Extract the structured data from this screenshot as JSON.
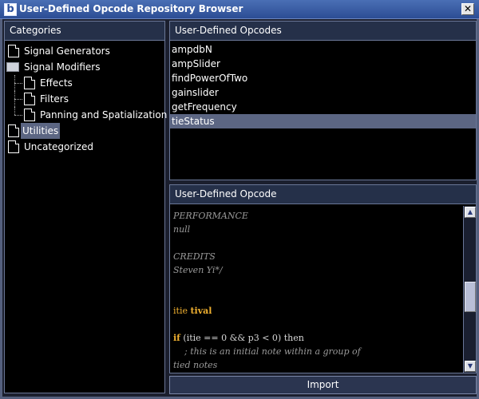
{
  "window": {
    "title": "User-Defined Opcode Repository Browser",
    "app_icon": "b",
    "close_glyph": "✕"
  },
  "categories": {
    "header": "Categories",
    "items": [
      {
        "label": "Signal Generators",
        "icon": "document-icon",
        "level": 0
      },
      {
        "label": "Signal Modifiers",
        "icon": "folder-icon",
        "level": 0
      },
      {
        "label": "Effects",
        "icon": "document-icon",
        "level": 1
      },
      {
        "label": "Filters",
        "icon": "document-icon",
        "level": 1
      },
      {
        "label": "Panning and Spatialization",
        "icon": "document-icon",
        "level": 1
      },
      {
        "label": "Utilities",
        "icon": "document-icon",
        "level": 0,
        "selected": true
      },
      {
        "label": "Uncategorized",
        "icon": "document-icon",
        "level": 0
      }
    ]
  },
  "opcodes": {
    "header": "User-Defined Opcodes",
    "items": [
      {
        "label": "ampdbN"
      },
      {
        "label": "ampSlider"
      },
      {
        "label": "findPowerOfTwo"
      },
      {
        "label": "gainslider"
      },
      {
        "label": "getFrequency"
      },
      {
        "label": "tieStatus",
        "selected": true
      }
    ]
  },
  "opcode_detail": {
    "header": "User-Defined Opcode",
    "code_lines": [
      "PERFORMANCE",
      "null",
      "",
      "CREDITS",
      "Steven Yi*/",
      "",
      "",
      "itie tival",
      "",
      "if (itie == 0 && p3 < 0) then",
      "    ; this is an initial note within a group of",
      "tied notes"
    ]
  },
  "import_button": "Import",
  "scrollbar": {
    "up_glyph": "▲",
    "down_glyph": "▼"
  }
}
